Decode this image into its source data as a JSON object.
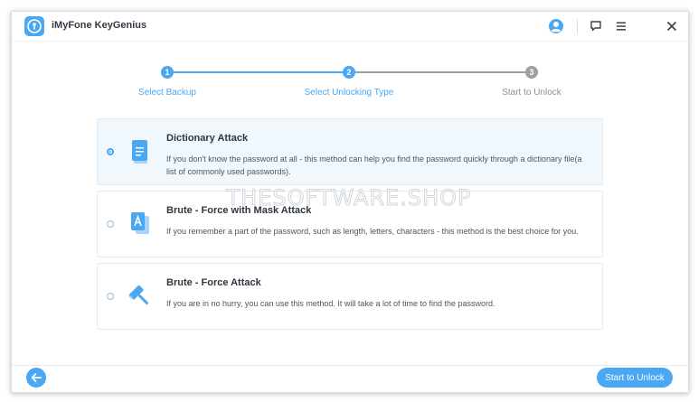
{
  "app": {
    "title": "iMyFone KeyGenius",
    "logo_icon": "keyhole-icon"
  },
  "titlebar": {
    "icons": [
      "user-account-icon",
      "feedback-icon",
      "menu-icon",
      "close-icon"
    ]
  },
  "steps": [
    {
      "number": "1",
      "label": "Select Backup",
      "state": "done"
    },
    {
      "number": "2",
      "label": "Select Unlocking Type",
      "state": "current"
    },
    {
      "number": "3",
      "label": "Start to Unlock",
      "state": "pending"
    }
  ],
  "options": [
    {
      "title": "Dictionary Attack",
      "description": "If you don't know the password at all - this method can help you find the password quickly through a dictionary file(a list of commonly used passwords).",
      "selected": true,
      "icon": "dictionary-book-icon"
    },
    {
      "title": "Brute - Force with Mask Attack",
      "description": "If you remember a part of the password, such as length, letters, characters - this method is the best choice for you.",
      "selected": false,
      "icon": "mask-letter-cards-icon"
    },
    {
      "title": "Brute - Force Attack",
      "description": "If you are in no hurry, you can use this method. It will take a lot of time to find the password.",
      "selected": false,
      "icon": "hammer-icon"
    }
  ],
  "footer": {
    "back_icon": "arrow-left-icon",
    "primary_label": "Start to Unlock"
  },
  "watermark": "THESOFTWARE.SHOP",
  "colors": {
    "accent": "#4aa7f3",
    "pending": "#9aa0a6",
    "selected_bg": "#f0f8fe",
    "text_dark": "#2f3640"
  }
}
